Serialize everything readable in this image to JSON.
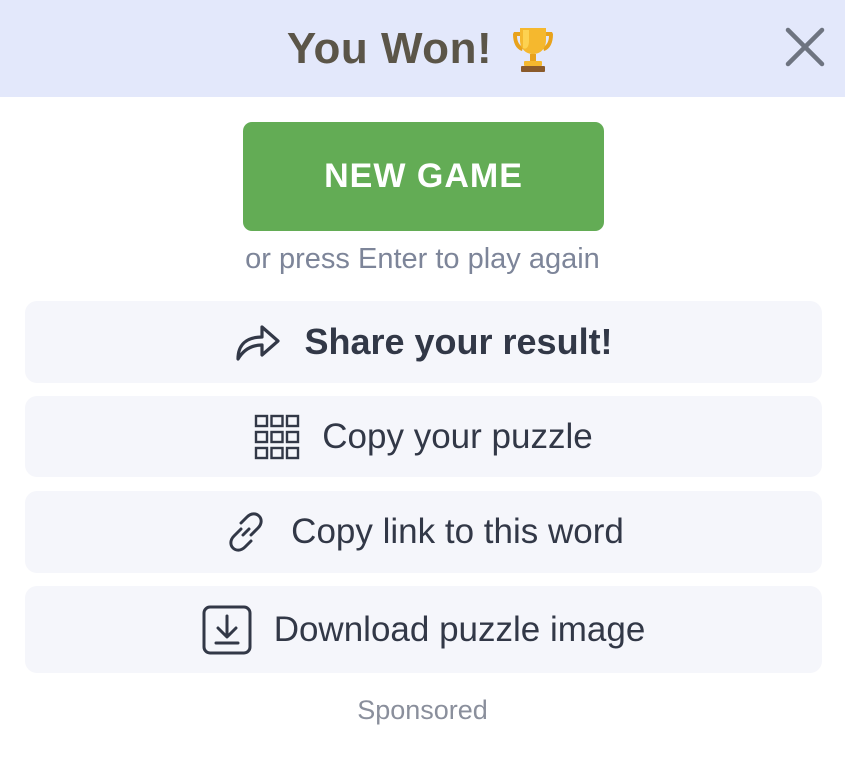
{
  "header": {
    "title": "You Won!",
    "trophy_icon": "trophy-icon",
    "close_icon": "close-icon"
  },
  "primary": {
    "new_game_label": "NEW GAME",
    "hint": "or press Enter to play again"
  },
  "actions": [
    {
      "label": "Share your result!",
      "icon": "share-arrow-icon"
    },
    {
      "label": "Copy your puzzle",
      "icon": "grid-icon"
    },
    {
      "label": "Copy link to this word",
      "icon": "link-icon"
    },
    {
      "label": "Download puzzle image",
      "icon": "download-icon"
    }
  ],
  "footer": {
    "sponsored": "Sponsored"
  },
  "colors": {
    "header_bg": "#e3e8fb",
    "title": "#5b5548",
    "primary_button": "#63ac55",
    "action_bg": "#f5f6fb",
    "action_text": "#323847",
    "hint_text": "#7d8599"
  }
}
